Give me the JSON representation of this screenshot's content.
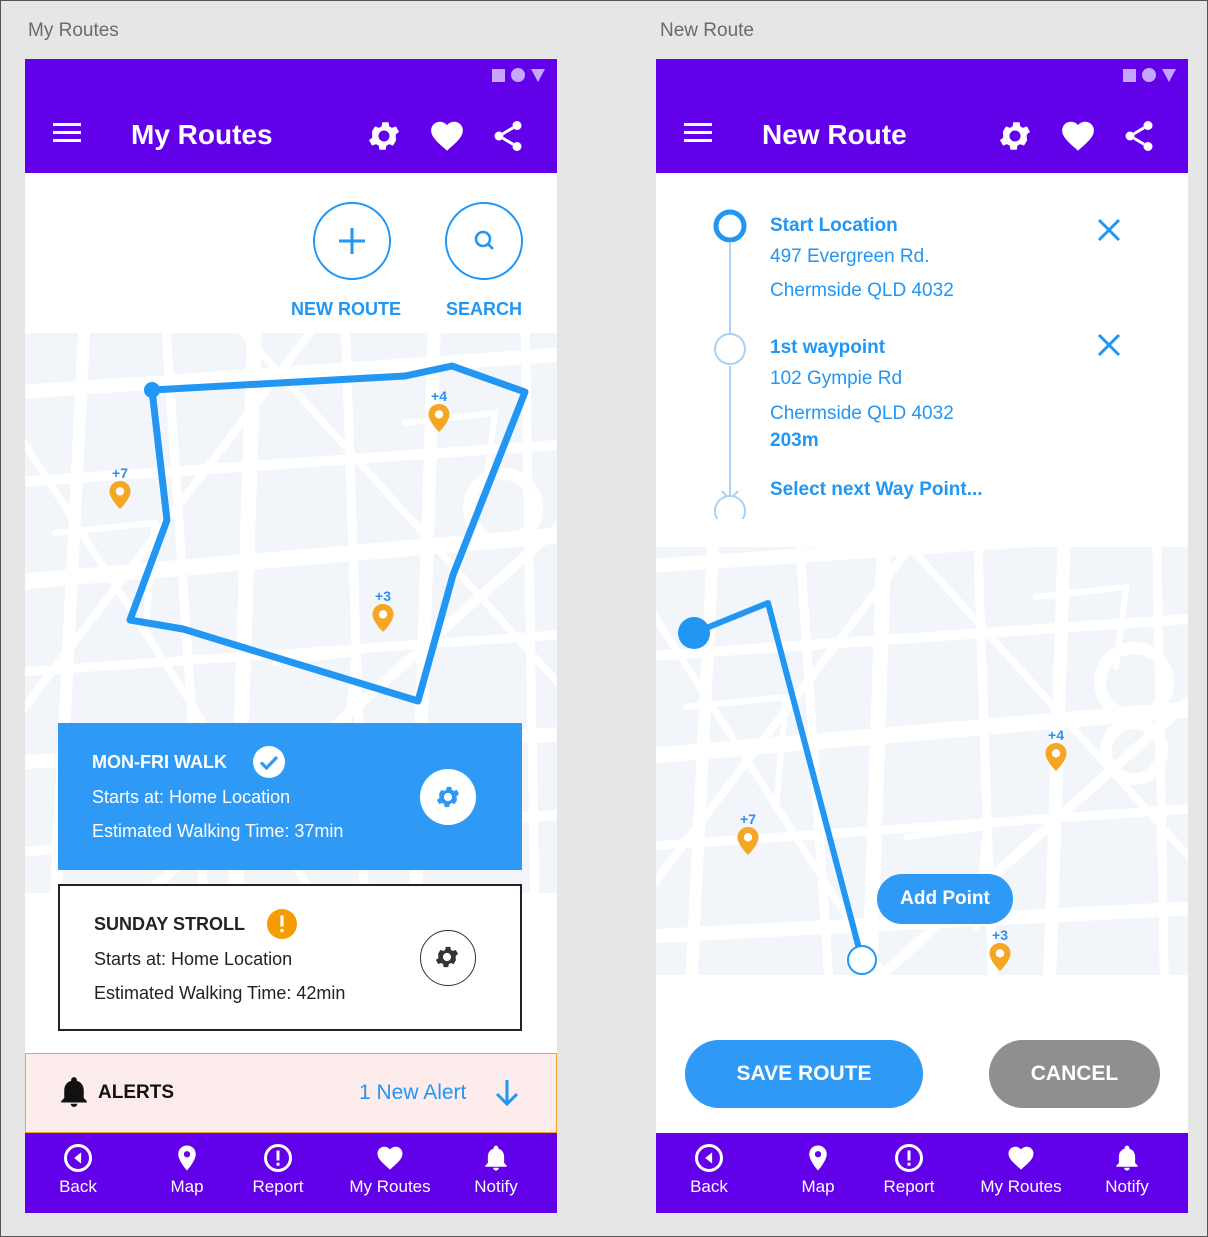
{
  "boards": {
    "left_label": "My Routes",
    "right_label": "New Route"
  },
  "colors": {
    "primary": "#6200ea",
    "accent_blue": "#2196f3",
    "pin_orange": "#f5a623",
    "warning_orange": "#f59c00",
    "cancel_gray": "#8f8f8f",
    "alert_bg": "#fdecec"
  },
  "my_routes": {
    "title": "My Routes",
    "toolbar_icons": [
      "gear-icon",
      "heart-icon",
      "share-icon"
    ],
    "actions": {
      "new_route_label": "NEW ROUTE",
      "search_label": "SEARCH"
    },
    "map_pins": [
      "+4",
      "+7",
      "+3"
    ],
    "routes": [
      {
        "name": "MON-FRI WALK",
        "starts": "Starts at: Home Location",
        "time": "Estimated Walking Time: 37min",
        "status": "check",
        "selected": true
      },
      {
        "name": "SUNDAY STROLL",
        "starts": "Starts at: Home Location",
        "time": "Estimated Walking Time: 42min",
        "status": "warning",
        "selected": false
      }
    ],
    "alerts": {
      "label": "ALERTS",
      "new_alert": "1 New Alert"
    }
  },
  "new_route": {
    "title": "New Route",
    "toolbar_icons": [
      "gear-icon",
      "heart-icon",
      "share-icon"
    ],
    "waypoints": [
      {
        "title": "Start Location",
        "line1": "497 Evergreen Rd.",
        "line2": "Chermside QLD 4032"
      },
      {
        "title": "1st waypoint",
        "line1": "102 Gympie Rd",
        "line2": "Chermside QLD 4032",
        "distance": "203m"
      }
    ],
    "next_waypoint": "Select next Way Point...",
    "map_pins": [
      "+4",
      "+7",
      "+3"
    ],
    "add_point_label": "Add Point",
    "save_label": "SAVE ROUTE",
    "cancel_label": "CANCEL"
  },
  "bottom_nav": [
    {
      "label": "Back",
      "icon": "back-icon"
    },
    {
      "label": "Map",
      "icon": "map-pin-icon"
    },
    {
      "label": "Report",
      "icon": "report-icon"
    },
    {
      "label": "My Routes",
      "icon": "heart-icon"
    },
    {
      "label": "Notify",
      "icon": "bell-icon"
    }
  ]
}
